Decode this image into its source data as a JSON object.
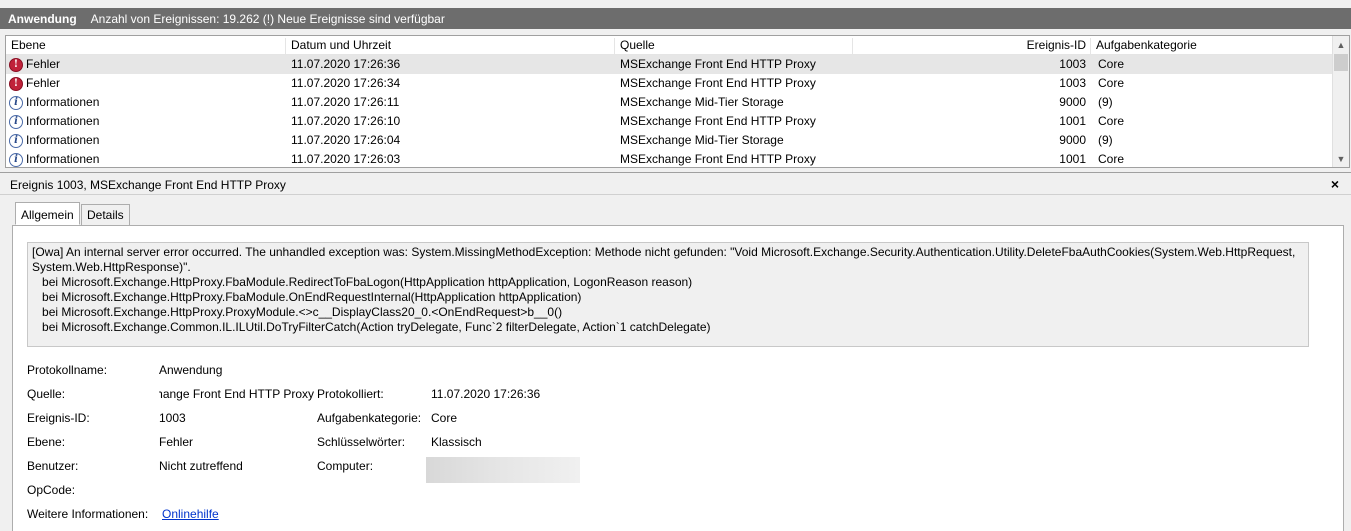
{
  "titlebar": {
    "app": "Anwendung",
    "info": "Anzahl von Ereignissen: 19.262 (!) Neue Ereignisse sind verfügbar"
  },
  "list": {
    "columns": [
      "Ebene",
      "Datum und Uhrzeit",
      "Quelle",
      "Ereignis-ID",
      "Aufgabenkategorie"
    ],
    "rows": [
      {
        "level": "Fehler",
        "icon": "error-icon",
        "date": "11.07.2020 17:26:36",
        "source": "MSExchange Front End HTTP Proxy",
        "id": "1003",
        "task": "Core"
      },
      {
        "level": "Fehler",
        "icon": "error-icon",
        "date": "11.07.2020 17:26:34",
        "source": "MSExchange Front End HTTP Proxy",
        "id": "1003",
        "task": "Core"
      },
      {
        "level": "Informationen",
        "icon": "info-icon",
        "date": "11.07.2020 17:26:11",
        "source": "MSExchange Mid-Tier Storage",
        "id": "9000",
        "task": "(9)"
      },
      {
        "level": "Informationen",
        "icon": "info-icon",
        "date": "11.07.2020 17:26:10",
        "source": "MSExchange Front End HTTP Proxy",
        "id": "1001",
        "task": "Core"
      },
      {
        "level": "Informationen",
        "icon": "info-icon",
        "date": "11.07.2020 17:26:04",
        "source": "MSExchange Mid-Tier Storage",
        "id": "9000",
        "task": "(9)"
      },
      {
        "level": "Informationen",
        "icon": "info-icon",
        "date": "11.07.2020 17:26:03",
        "source": "MSExchange Front End HTTP Proxy",
        "id": "1001",
        "task": "Core"
      }
    ]
  },
  "details": {
    "title": "Ereignis 1003, MSExchange Front End HTTP Proxy",
    "close": "×",
    "tabs": [
      "Allgemein",
      "Details"
    ],
    "message": "[Owa] An internal server error occurred. The unhandled exception was: System.MissingMethodException: Methode nicht gefunden: \"Void Microsoft.Exchange.Security.Authentication.Utility.DeleteFbaAuthCookies(System.Web.HttpRequest, System.Web.HttpResponse)\".\n   bei Microsoft.Exchange.HttpProxy.FbaModule.RedirectToFbaLogon(HttpApplication httpApplication, LogonReason reason)\n   bei Microsoft.Exchange.HttpProxy.FbaModule.OnEndRequestInternal(HttpApplication httpApplication)\n   bei Microsoft.Exchange.HttpProxy.ProxyModule.<>c__DisplayClass20_0.<OnEndRequest>b__0()\n   bei Microsoft.Exchange.Common.IL.ILUtil.DoTryFilterCatch(Action tryDelegate, Func`2 filterDelegate, Action`1 catchDelegate)",
    "props": {
      "protokollname_label": "Protokollname:",
      "protokollname": "Anwendung",
      "quelle_label": "Quelle:",
      "quelle": "MSExchange Front End HTTP Proxy",
      "protokolliert_label": "Protokolliert:",
      "protokolliert": "11.07.2020 17:26:36",
      "id_label": "Ereignis-ID:",
      "id": "1003",
      "task_label": "Aufgabenkategorie:",
      "task": "Core",
      "ebene_label": "Ebene:",
      "ebene": "Fehler",
      "keywords_label": "Schlüsselwörter:",
      "keywords": "Klassisch",
      "benutzer_label": "Benutzer:",
      "benutzer": "Nicht zutreffend",
      "computer_label": "Computer:",
      "opcode_label": "OpCode:",
      "more_label": "Weitere Informationen:",
      "more_link": "Onlinehilfe"
    }
  }
}
